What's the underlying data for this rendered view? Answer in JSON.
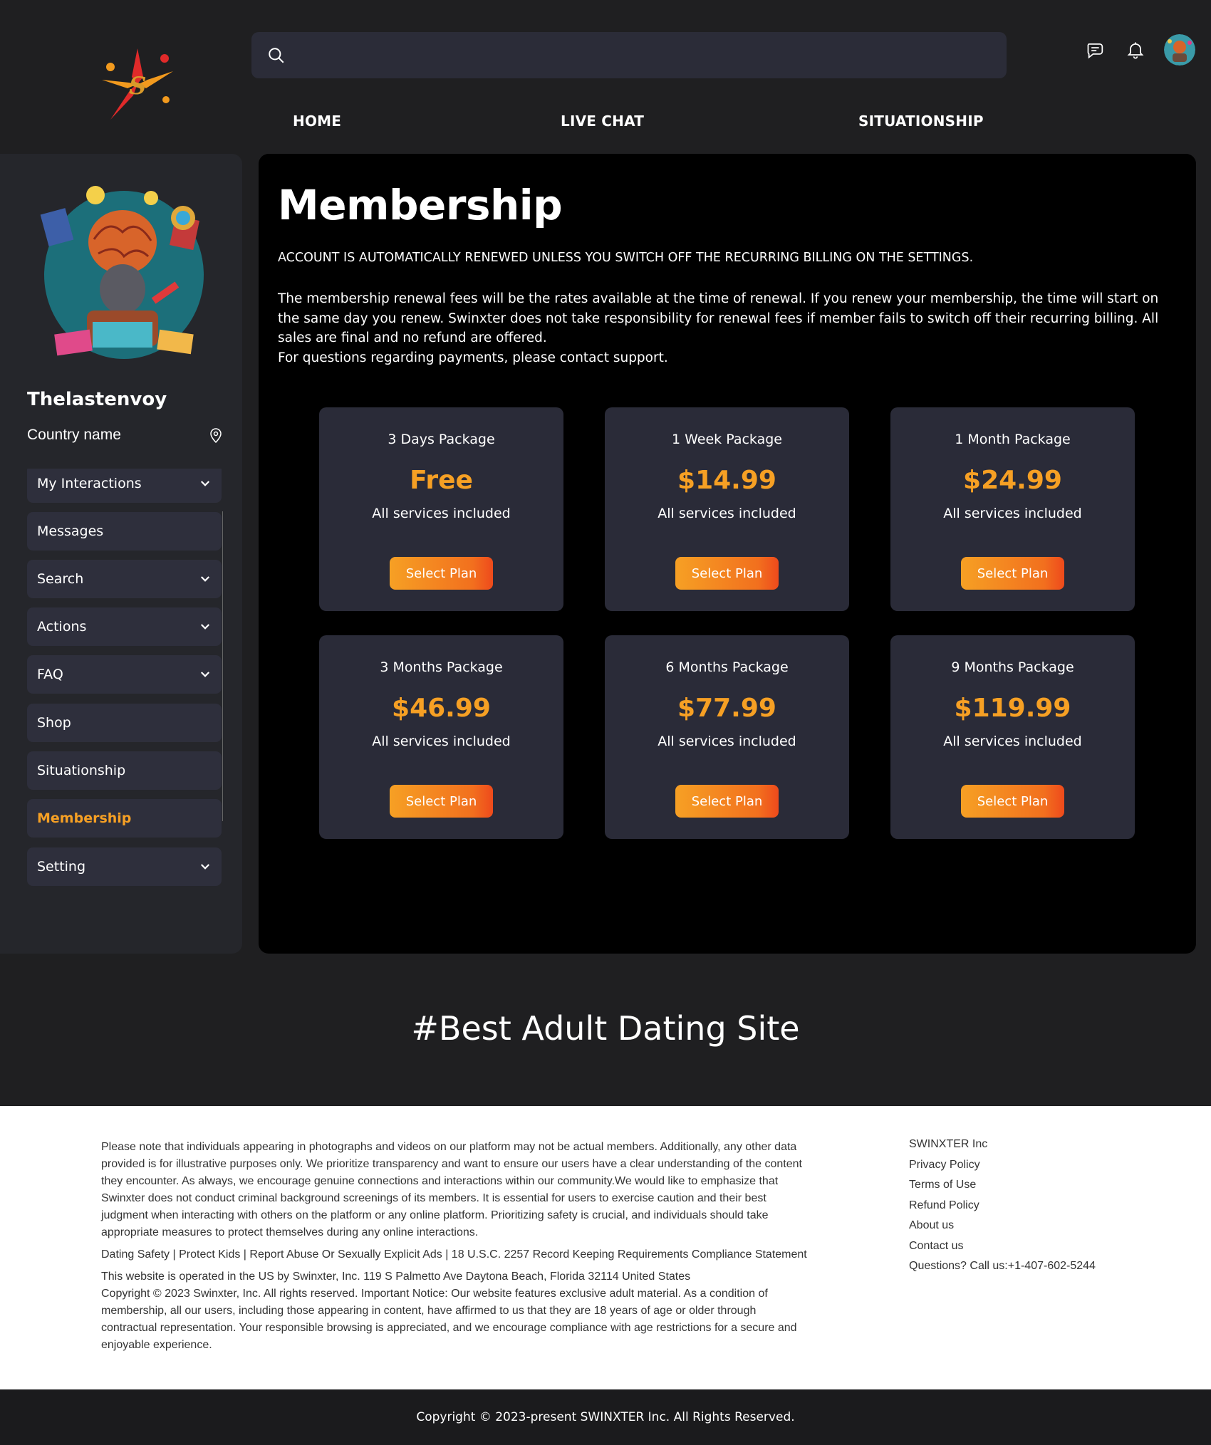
{
  "header": {
    "search_placeholder": "",
    "nav": [
      {
        "label": "HOME"
      },
      {
        "label": "LIVE CHAT"
      },
      {
        "label": "SITUATIONSHIP"
      }
    ]
  },
  "sidebar": {
    "username": "Thelastenvoy",
    "country": "Country name",
    "menu": [
      {
        "label": "My Interactions",
        "has_dropdown": true
      },
      {
        "label": "Messages",
        "has_dropdown": false
      },
      {
        "label": "Search",
        "has_dropdown": true
      },
      {
        "label": "Actions",
        "has_dropdown": true
      },
      {
        "label": "FAQ",
        "has_dropdown": true
      },
      {
        "label": "Shop",
        "has_dropdown": false
      },
      {
        "label": "Situationship",
        "has_dropdown": false
      },
      {
        "label": "Membership",
        "has_dropdown": false,
        "active": true
      },
      {
        "label": "Setting",
        "has_dropdown": true
      }
    ]
  },
  "main": {
    "title": "Membership",
    "notice_caps": "ACCOUNT IS AUTOMATICALLY RENEWED UNLESS YOU SWITCH OFF THE RECURRING BILLING ON THE SETTINGS.",
    "notice_body": "The membership renewal fees will be the rates available at the time of renewal. If you renew your membership, the time will start on the same day you renew. Swinxter does not take responsibility for renewal fees if member fails to switch off their recurring billing. All sales are final and no refund are offered.",
    "notice_support": "For questions regarding payments, please contact support.",
    "packages": [
      {
        "name": "3 Days Package",
        "price": "Free",
        "included": "All services included",
        "button": "Select Plan"
      },
      {
        "name": "1 Week Package",
        "price": "$14.99",
        "included": "All services included",
        "button": "Select Plan"
      },
      {
        "name": "1 Month Package",
        "price": "$24.99",
        "included": "All services included",
        "button": "Select Plan"
      },
      {
        "name": "3 Months Package",
        "price": "$46.99",
        "included": "All services included",
        "button": "Select Plan"
      },
      {
        "name": "6 Months Package",
        "price": "$77.99",
        "included": "All services included",
        "button": "Select Plan"
      },
      {
        "name": "9 Months Package",
        "price": "$119.99",
        "included": "All services included",
        "button": "Select Plan"
      }
    ]
  },
  "tagline": "#Best Adult Dating Site",
  "footer": {
    "disclaimer": "Please note that individuals appearing in photographs and videos on our platform may not be actual members. Additionally, any other data provided is for illustrative purposes only. We prioritize transparency and want to ensure our users have a clear understanding of the content they encounter. As always, we encourage genuine connections and interactions within our community.We would like to emphasize that Swinxter does not conduct criminal background screenings of its members. It is essential for users to exercise caution and their best judgment when interacting with others on the platform or any online platform. Prioritizing safety is crucial, and individuals should take appropriate measures to protect themselves during any online interactions.",
    "policy_line": "Dating Safety | Protect Kids | Report Abuse Or Sexually Explicit Ads | 18 U.S.C. 2257 Record Keeping Requirements Compliance Statement",
    "operator": "This website is operated in the US by Swinxter, Inc. 119 S Palmetto Ave Daytona Beach, Florida 32114 United States",
    "copyright_notice": "Copyright © 2023 Swinxter, Inc. All rights reserved. Important Notice: Our website features exclusive adult material. As a condition of membership, all our users, including those appearing in content, have affirmed to us that they are 18 years of age or older through contractual representation. Your responsible browsing is appreciated, and we encourage compliance with age restrictions for a secure and enjoyable experience.",
    "links": [
      {
        "label": "SWINXTER Inc"
      },
      {
        "label": "Privacy Policy"
      },
      {
        "label": "Terms of Use"
      },
      {
        "label": "Refund Policy"
      },
      {
        "label": "About us"
      },
      {
        "label": "Contact us"
      },
      {
        "label": "Questions? Call us:+1-407-602-5244"
      }
    ],
    "bottom": "Copyright © 2023-present SWINXTER Inc. All Rights Reserved."
  },
  "colors": {
    "accent": "#f6a024",
    "card": "#2a2b38",
    "sidebar": "#25262b"
  }
}
